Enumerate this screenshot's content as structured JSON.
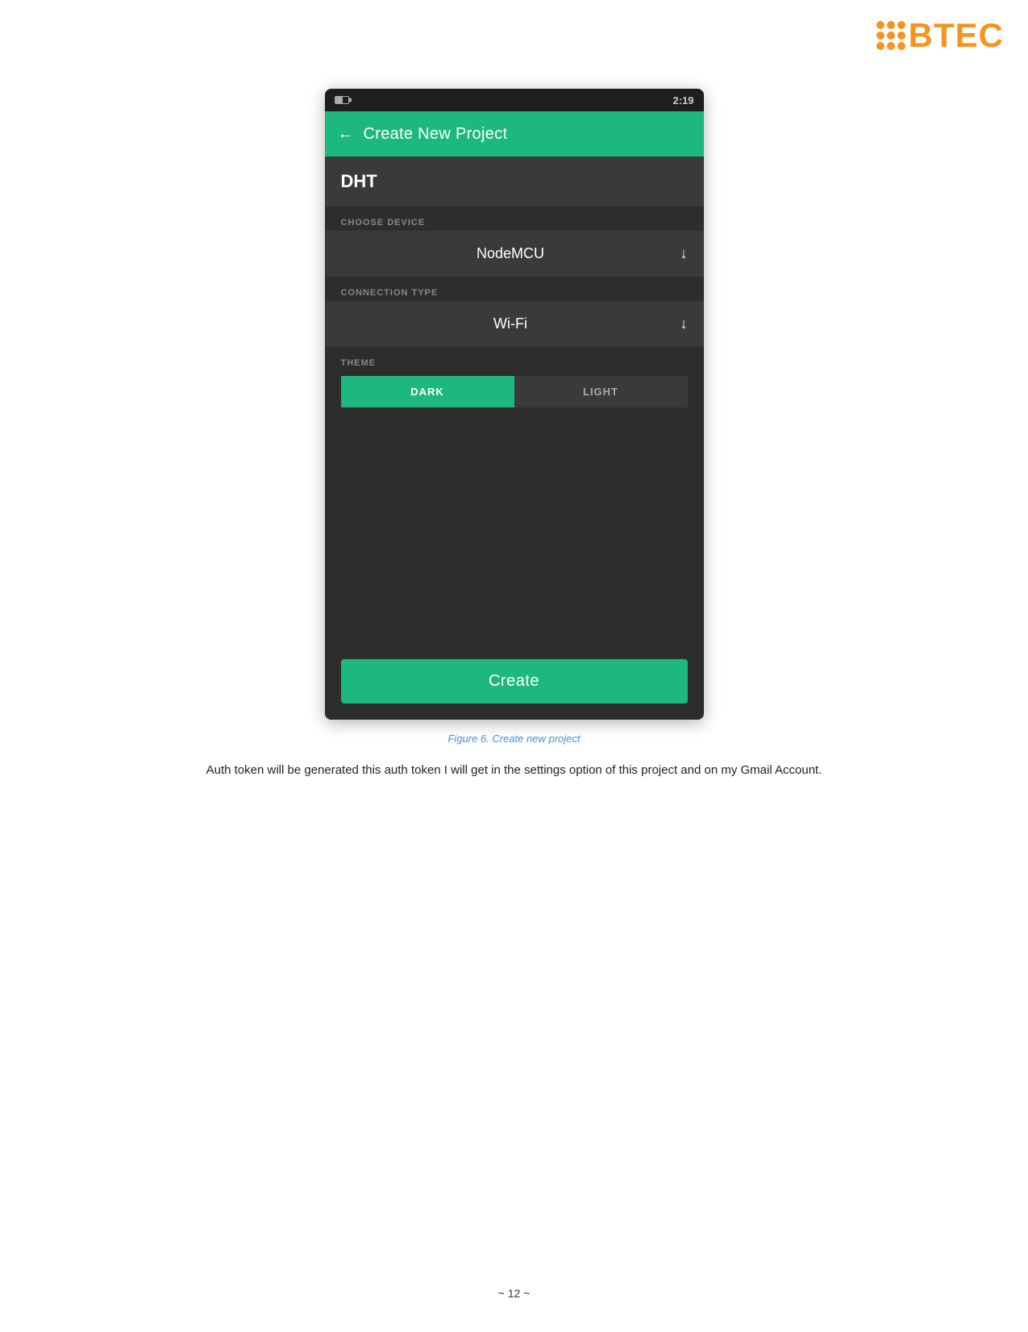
{
  "logo": {
    "text": "BTEC",
    "dots_count": 9
  },
  "status_bar": {
    "time": "2:19"
  },
  "header": {
    "back_label": "←",
    "title": "Create New Project"
  },
  "form": {
    "project_name": {
      "value": "DHT",
      "placeholder": "DHT"
    },
    "device_section": {
      "label": "CHOOSE DEVICE",
      "value": "NodeMCU",
      "arrow": "↓"
    },
    "connection_section": {
      "label": "CONNECTION TYPE",
      "value": "Wi-Fi",
      "arrow": "↓"
    },
    "theme_section": {
      "label": "THEME",
      "dark_btn": "DARK",
      "light_btn": "LIGHT"
    },
    "create_button": "Create"
  },
  "figure_caption": "Figure 6. Create new project",
  "body_text": "Auth token will be generated this auth token I will get in the settings option of this project and on my Gmail Account.",
  "page_number": "~ 12 ~"
}
